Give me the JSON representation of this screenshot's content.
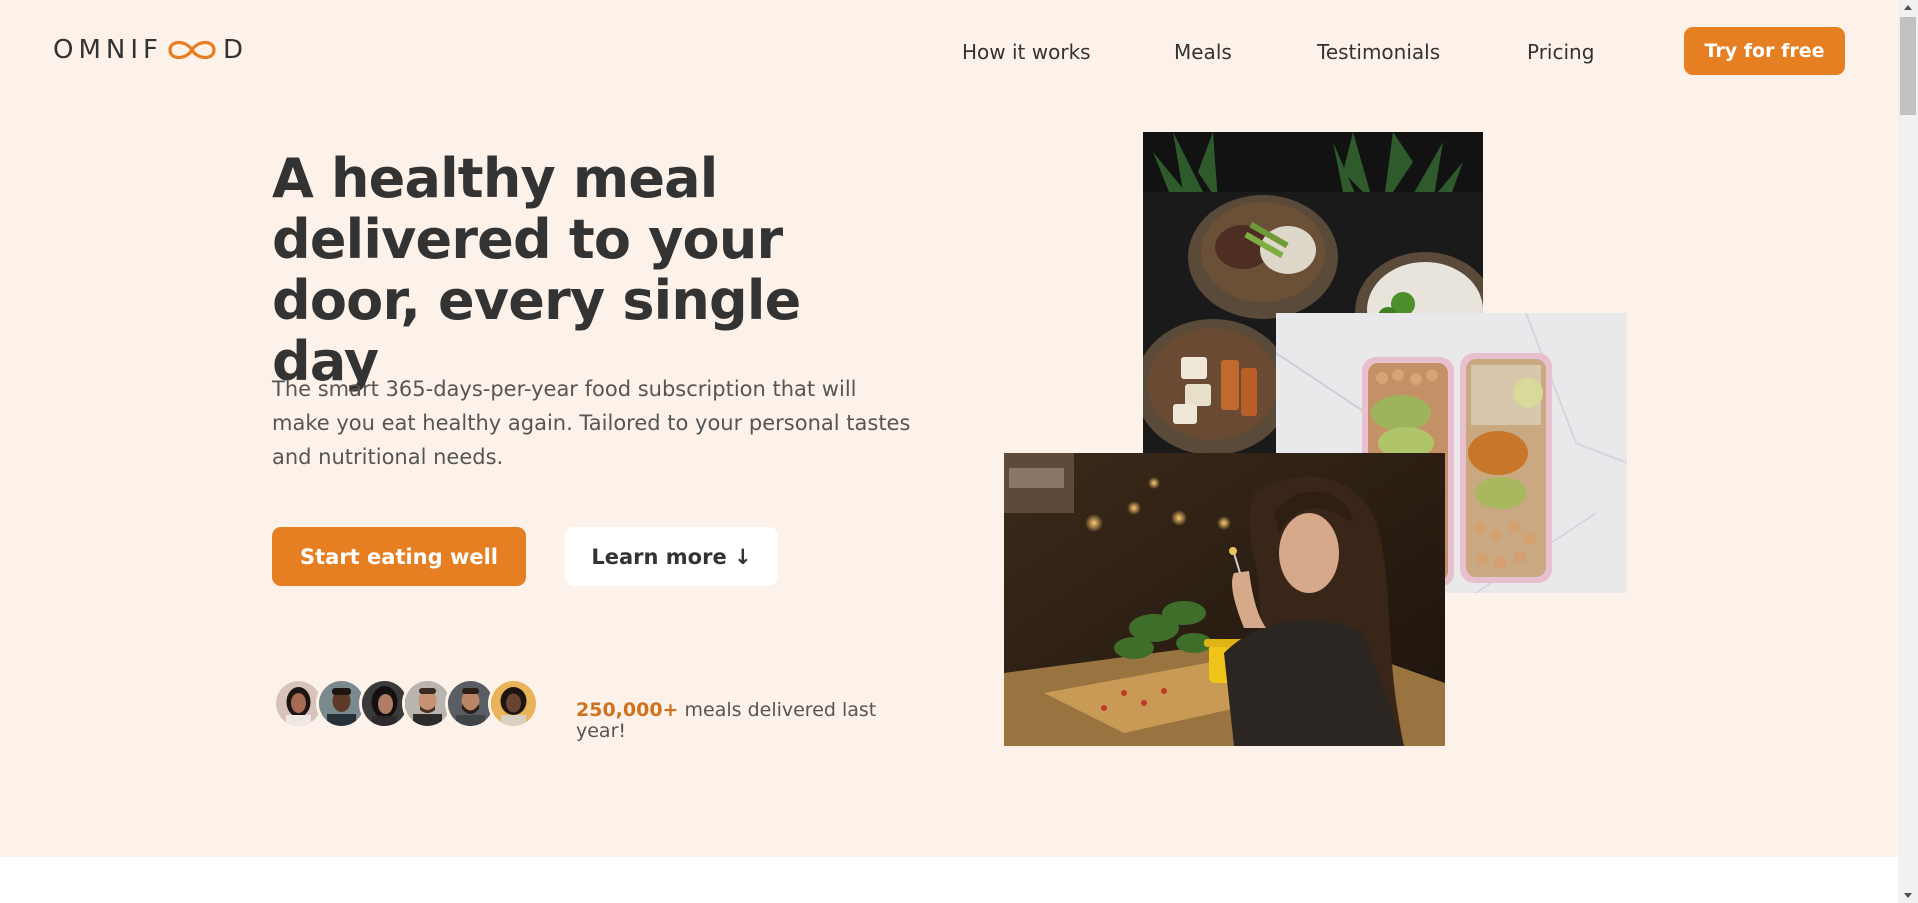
{
  "colors": {
    "background": "#fdf2e9",
    "accent": "#e67e22",
    "accent_dark": "#cf711f",
    "text": "#333333",
    "muted_text": "#555555"
  },
  "header": {
    "logo_left": "OMNIF",
    "logo_right": "D",
    "logo_icon": "infinity-icon",
    "nav": [
      {
        "label": "How it works"
      },
      {
        "label": "Meals"
      },
      {
        "label": "Testimonials"
      },
      {
        "label": "Pricing"
      }
    ],
    "cta_label": "Try for free"
  },
  "hero": {
    "title": "A healthy meal delivered to your door, every single day",
    "description": "The smart 365-days-per-year food subscription that will make you eat healthy again. Tailored to your personal tastes and nutritional needs.",
    "primary_button": "Start eating well",
    "secondary_button": "Learn more ↓",
    "delivered_count": "250,000+",
    "delivered_text": " meals delivered last year!"
  },
  "images": {
    "bowls": "meal-bowls-photo",
    "boxes": "meal-prep-boxes-photo",
    "woman": "woman-eating-photo"
  }
}
